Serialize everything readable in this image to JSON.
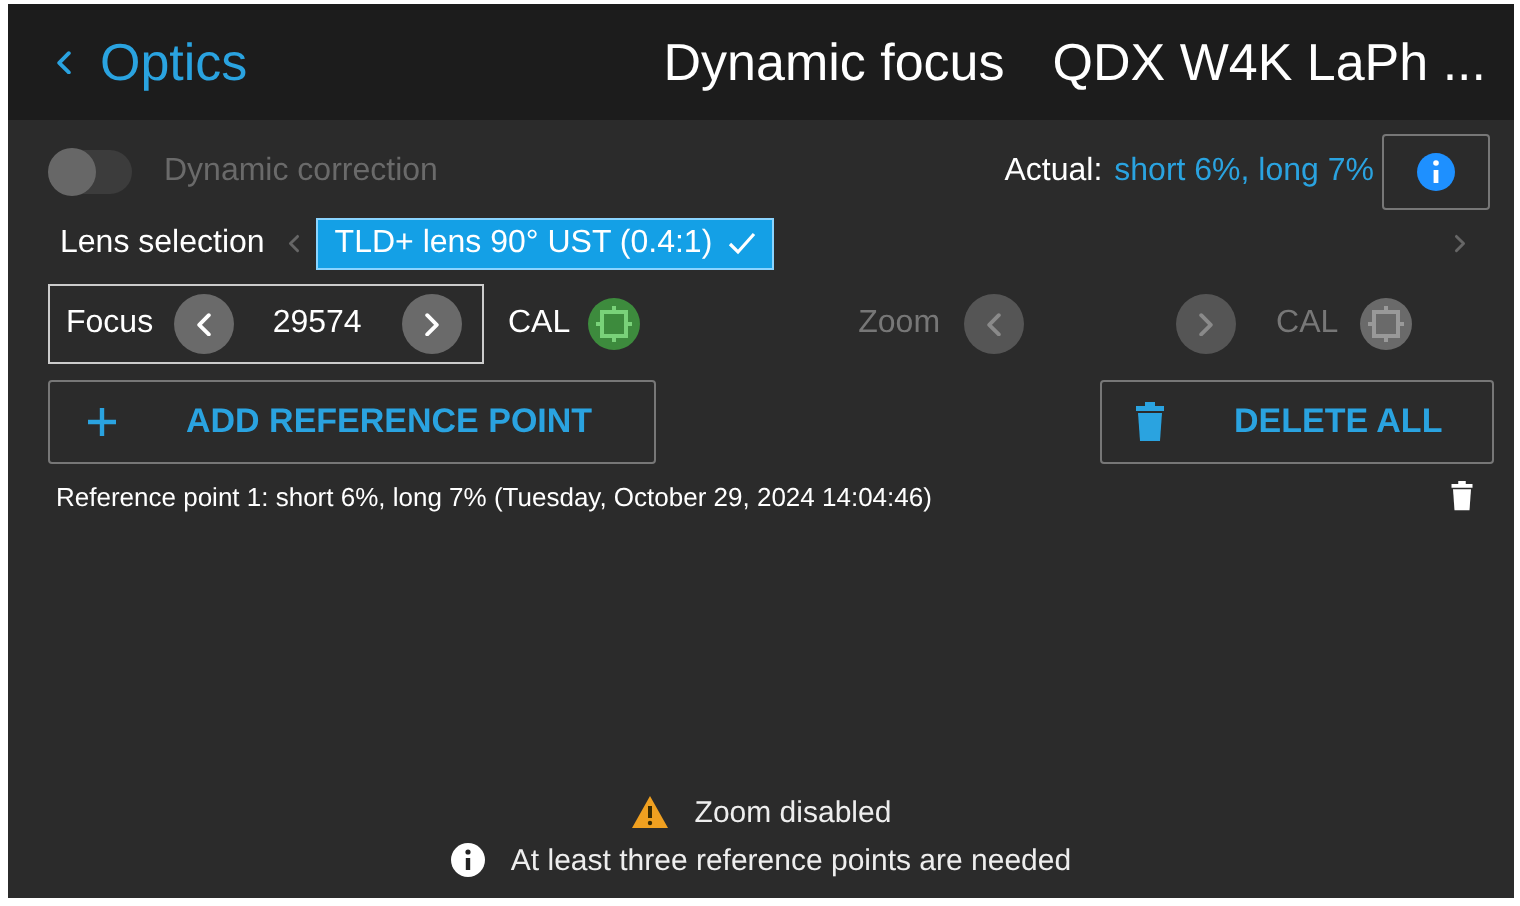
{
  "header": {
    "back_label": "Optics",
    "title": "Dynamic focus",
    "device": "QDX W4K LaPh ..."
  },
  "dynamic_correction": {
    "label": "Dynamic correction",
    "on": false,
    "disabled": true
  },
  "actual": {
    "label": "Actual:",
    "value": "short 6%, long 7%"
  },
  "lens_selection": {
    "label": "Lens selection",
    "options": [
      {
        "label": "TLD+ lens 90° UST (0.4:1)",
        "selected": true
      }
    ]
  },
  "focus": {
    "label": "Focus",
    "value": "29574",
    "cal_label": "CAL",
    "disabled": false
  },
  "zoom": {
    "label": "Zoom",
    "cal_label": "CAL",
    "disabled": true
  },
  "buttons": [
    {
      "kind": "add",
      "label": "ADD REFERENCE POINT"
    },
    {
      "kind": "delete",
      "label": "DELETE ALL"
    }
  ],
  "reference_points": [
    "Reference point 1: short 6%, long 7% (Tuesday, October 29, 2024 14:04:46)"
  ],
  "messages": [
    {
      "kind": "warning",
      "text": "Zoom disabled"
    },
    {
      "kind": "info",
      "text": "At least three reference points are needed"
    }
  ]
}
